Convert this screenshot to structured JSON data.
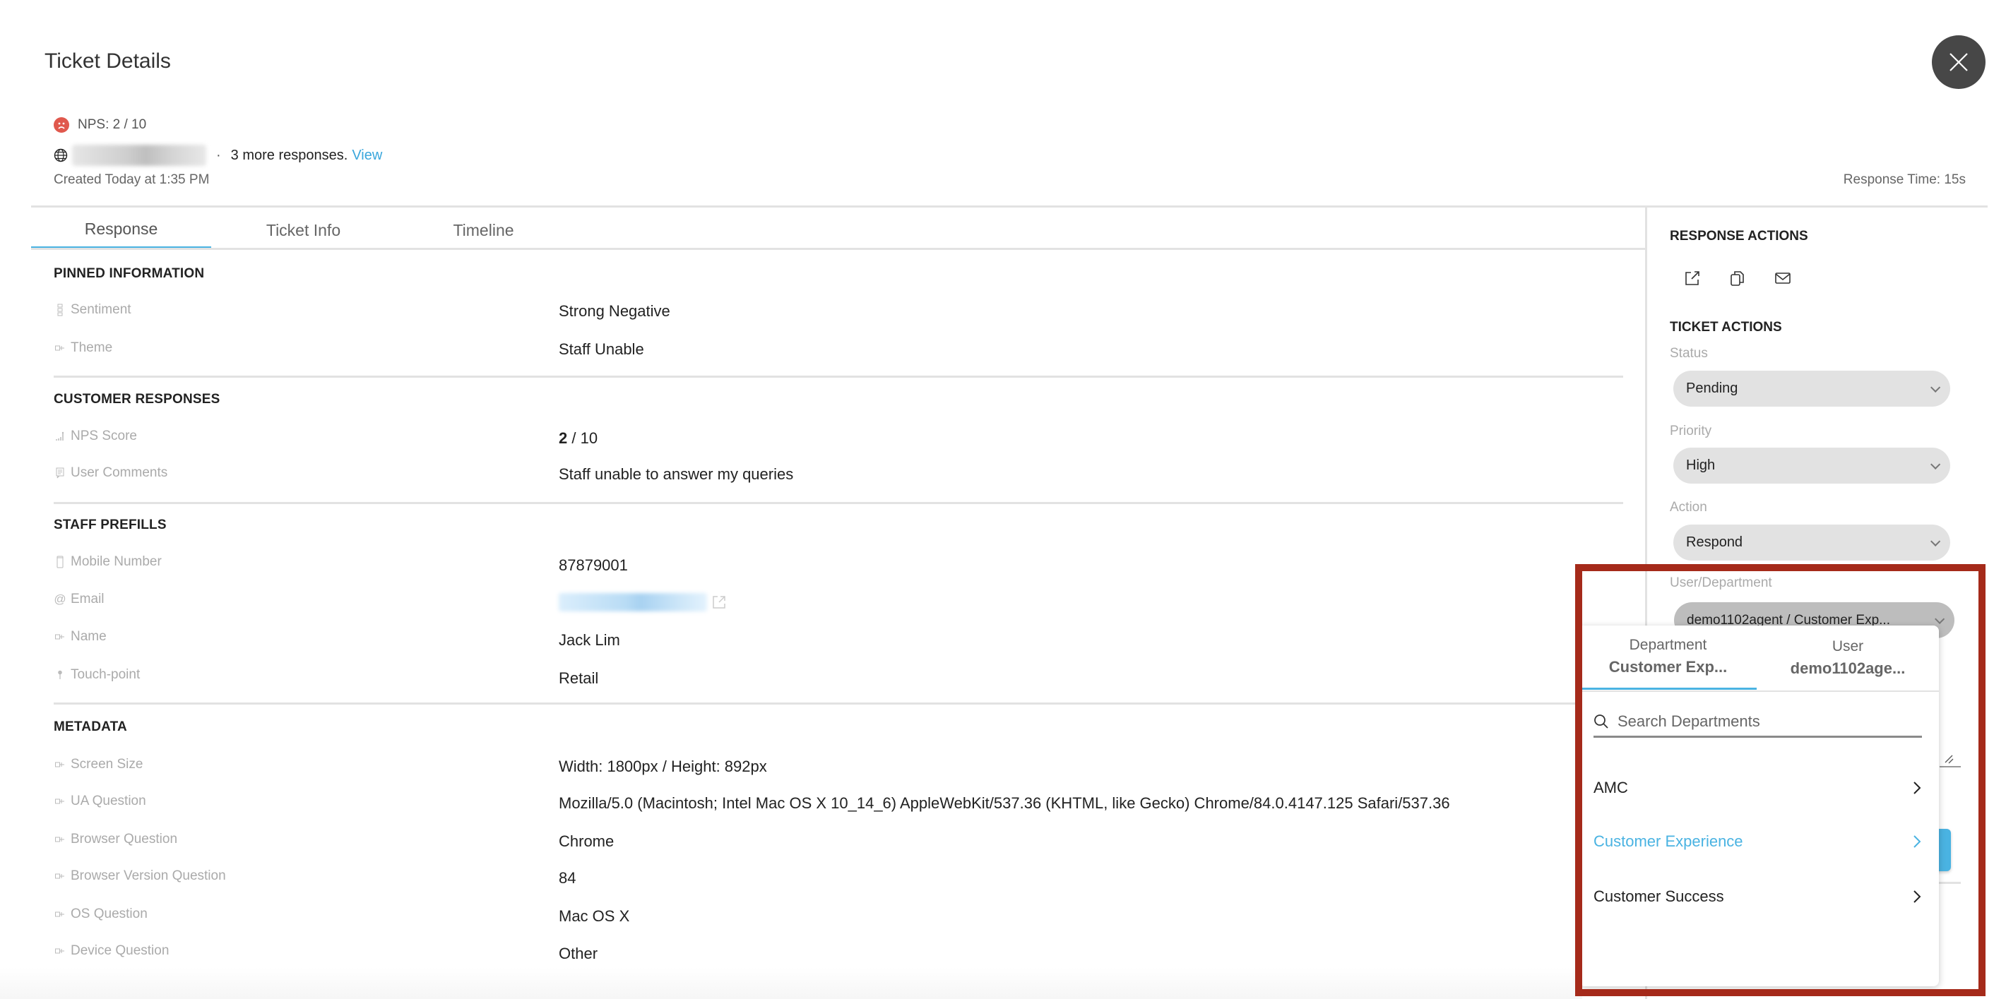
{
  "header": {
    "title": "Ticket Details",
    "nps_text": "NPS: 2 / 10",
    "more_responses": "3 more responses.",
    "view_link": "View",
    "separator": "·",
    "created": "Created Today at 1:35 PM",
    "response_time": "Response Time: 15s"
  },
  "tabs": [
    {
      "label": "Response",
      "active": true
    },
    {
      "label": "Ticket Info",
      "active": false
    },
    {
      "label": "Timeline",
      "active": false
    }
  ],
  "sections": {
    "pinned": {
      "title": "PINNED INFORMATION",
      "rows": [
        {
          "label": "Sentiment",
          "icon": "sentiment-icon",
          "value": "Strong Negative"
        },
        {
          "label": "Theme",
          "icon": "tag-icon",
          "value": "Staff Unable"
        }
      ]
    },
    "customer": {
      "title": "CUSTOMER RESPONSES",
      "rows": [
        {
          "label": "NPS Score",
          "icon": "bar-chart-icon",
          "value_bold": "2",
          "value_rest": " / 10"
        },
        {
          "label": "User Comments",
          "icon": "comment-icon",
          "value": "Staff unable to answer my queries"
        }
      ]
    },
    "staff": {
      "title": "STAFF PREFILLS",
      "rows": [
        {
          "label": "Mobile Number",
          "icon": "mobile-icon",
          "value": "87879001"
        },
        {
          "label": "Email",
          "icon": "at-icon",
          "value": ""
        },
        {
          "label": "Name",
          "icon": "tag-icon",
          "value": "Jack Lim"
        },
        {
          "label": "Touch-point",
          "icon": "pin-icon",
          "value": "Retail"
        }
      ]
    },
    "metadata": {
      "title": "METADATA",
      "rows": [
        {
          "label": "Screen Size",
          "icon": "tag-icon",
          "value": "Width: 1800px / Height: 892px"
        },
        {
          "label": "UA Question",
          "icon": "tag-icon",
          "value": "Mozilla/5.0 (Macintosh; Intel Mac OS X 10_14_6) AppleWebKit/537.36 (KHTML, like Gecko) Chrome/84.0.4147.125 Safari/537.36"
        },
        {
          "label": "Browser Question",
          "icon": "tag-icon",
          "value": "Chrome"
        },
        {
          "label": "Browser Version Question",
          "icon": "tag-icon",
          "value": "84"
        },
        {
          "label": "OS Question",
          "icon": "tag-icon",
          "value": "Mac OS X"
        },
        {
          "label": "Device Question",
          "icon": "tag-icon",
          "value": "Other"
        }
      ]
    }
  },
  "right_panel": {
    "response_actions_title": "RESPONSE ACTIONS",
    "response_action_icons": [
      "external-link-icon",
      "copy-icon",
      "mail-icon"
    ],
    "ticket_actions_title": "TICKET ACTIONS",
    "status": {
      "label": "Status",
      "value": "Pending"
    },
    "priority": {
      "label": "Priority",
      "value": "High"
    },
    "action": {
      "label": "Action",
      "value": "Respond"
    },
    "user_department": {
      "label": "User/Department",
      "value": "demo1102agent / Customer Exp..."
    }
  },
  "dropdown": {
    "tabs": [
      {
        "label": "Department",
        "value": "Customer Exp...",
        "active": true
      },
      {
        "label": "User",
        "value": "demo1102age...",
        "active": false
      }
    ],
    "search_placeholder": "Search Departments",
    "items": [
      {
        "label": "AMC",
        "selected": false
      },
      {
        "label": "Customer Experience",
        "selected": true
      },
      {
        "label": "Customer Success",
        "selected": false
      }
    ]
  },
  "colors": {
    "accent": "#4ab3e2",
    "nps_negative": "#e0584d",
    "highlight_frame": "#a52a1a",
    "close_button": "#474747"
  }
}
